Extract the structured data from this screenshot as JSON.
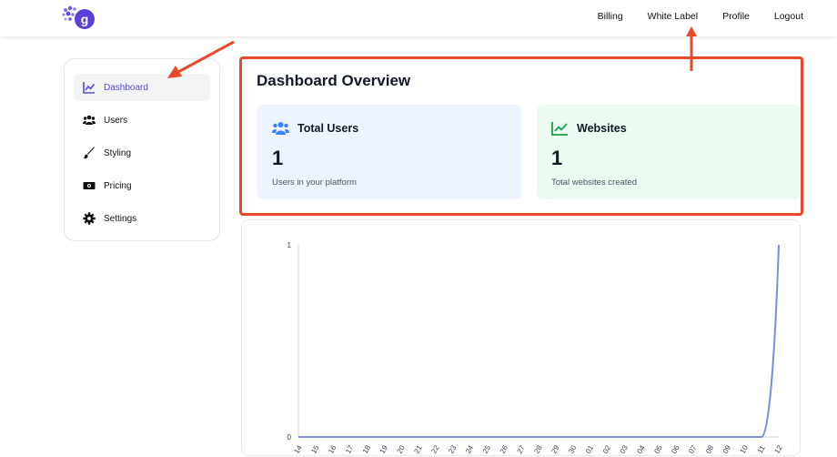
{
  "nav": {
    "billing": "Billing",
    "white_label": "White Label",
    "profile": "Profile",
    "logout": "Logout"
  },
  "sidebar": {
    "items": [
      {
        "label": "Dashboard",
        "icon": "chart-line-icon",
        "active": true
      },
      {
        "label": "Users",
        "icon": "users-icon"
      },
      {
        "label": "Styling",
        "icon": "brush-icon"
      },
      {
        "label": "Pricing",
        "icon": "money-bill-icon"
      },
      {
        "label": "Settings",
        "icon": "gear-icon"
      }
    ]
  },
  "overview": {
    "title": "Dashboard Overview",
    "users_card": {
      "title": "Total Users",
      "value": "1",
      "subtitle": "Users in your platform"
    },
    "websites_card": {
      "title": "Websites",
      "value": "1",
      "subtitle": "Total websites created"
    }
  },
  "colors": {
    "accent": "#5b4bdb",
    "annotation": "#e8492a",
    "users_icon": "#3b82f6",
    "websites_icon": "#16a34a",
    "line": "#7b8ee0"
  },
  "chart_data": {
    "type": "line",
    "x": [
      "14",
      "15",
      "16",
      "17",
      "18",
      "19",
      "20",
      "21",
      "22",
      "23",
      "24",
      "25",
      "26",
      "27",
      "28",
      "29",
      "30",
      "01",
      "02",
      "03",
      "04",
      "05",
      "06",
      "07",
      "08",
      "09",
      "10",
      "11",
      "12"
    ],
    "series": [
      {
        "values": [
          0,
          0,
          0,
          0,
          0,
          0,
          0,
          0,
          0,
          0,
          0,
          0,
          0,
          0,
          0,
          0,
          0,
          0,
          0,
          0,
          0,
          0,
          0,
          0,
          0,
          0,
          0,
          0,
          1
        ]
      }
    ],
    "ylim": [
      0,
      1
    ],
    "yticks": [
      "0",
      "1"
    ]
  }
}
